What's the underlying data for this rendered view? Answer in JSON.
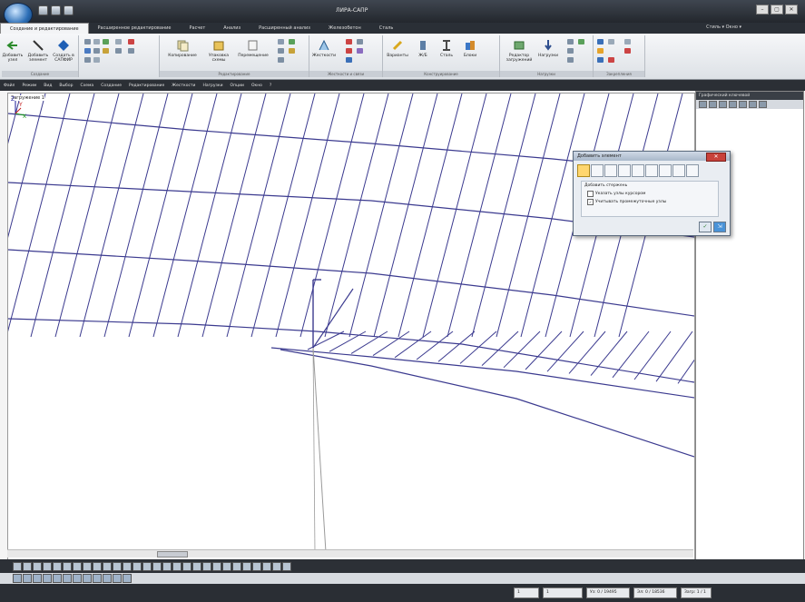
{
  "titlebar": {
    "title": "ЛИРА-САПР",
    "window_controls": [
      "–",
      "▢",
      "✕"
    ]
  },
  "ribbon": {
    "tabs": [
      {
        "label": "Создание и редактирование",
        "active": true
      },
      {
        "label": "Расширенное редактирование",
        "active": false
      },
      {
        "label": "Расчет",
        "active": false
      },
      {
        "label": "Анализ",
        "active": false
      },
      {
        "label": "Расширенный анализ",
        "active": false
      },
      {
        "label": "Железобетон",
        "active": false
      },
      {
        "label": "Сталь",
        "active": false
      }
    ],
    "style_menu": "Стиль ▾   Окно ▾",
    "groups": [
      {
        "label": "Создание",
        "buttons": [
          "Добавить узел",
          "Добавить элемент",
          "Создать в САПФИР"
        ]
      },
      {
        "label": "Редактирование",
        "buttons": [
          "Копирование",
          "Упаковка схемы",
          "Перемещение"
        ]
      },
      {
        "label": "Жесткости и связи",
        "buttons": [
          "Жесткости"
        ]
      },
      {
        "label": "Конструирование",
        "buttons": [
          "Варианты",
          "Ж/Б",
          "Сталь",
          "Блоки"
        ]
      },
      {
        "label": "Нагрузки",
        "buttons": [
          "Редактор загружений",
          "Нагрузки"
        ]
      },
      {
        "label": "Закрепления",
        "buttons": []
      }
    ]
  },
  "menubar": {
    "items": [
      "Файл",
      "Режим",
      "Вид",
      "Выбор",
      "Схема",
      "Создание",
      "Редактирование",
      "Жесткости",
      "Нагрузки",
      "Опции",
      "Окно",
      "?"
    ]
  },
  "viewport": {
    "load_case_label": "Загружение 1",
    "axis_labels": {
      "z": "Z",
      "y": "Y",
      "x": "X"
    }
  },
  "right_panel": {
    "title": "Графический ключевой"
  },
  "dialog": {
    "title": "Добавить элемент",
    "section_title": "Добавить стержень",
    "options": [
      {
        "label": "Указать узлы курсором",
        "checked": false
      },
      {
        "label": "Учитывать промежуточные узлы",
        "checked": true
      }
    ],
    "apply_label": "✓",
    "ok_label": "⇲"
  },
  "statusbar": {
    "fields": [
      "1",
      "1",
      "Уз: 0 / 19495",
      "Эл: 0 / 18536",
      "Загр: 1 / 1"
    ]
  },
  "colors": {
    "mesh": "#3b3a8f",
    "bar": "#9a9a9a",
    "ribbon_dark": "#2b2f35",
    "accent": "#ffd66e"
  }
}
